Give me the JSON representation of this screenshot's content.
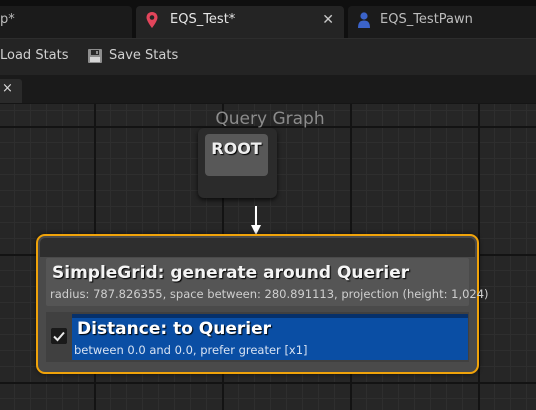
{
  "tabs": [
    {
      "label": "p*"
    },
    {
      "label": "EQS_Test*",
      "active": true,
      "icon": "location-pin-icon"
    },
    {
      "label": "EQS_TestPawn",
      "icon": "pawn-icon"
    }
  ],
  "toolbar": {
    "load_label": "Load Stats",
    "save_label": "Save Stats"
  },
  "strip": {
    "close_glyph": "×"
  },
  "graph": {
    "title": "Query Graph",
    "root_label": "ROOT",
    "generator": {
      "title": "SimpleGrid: generate around Querier",
      "description": "radius: 787.826355, space between: 280.891113, projection (height: 1,024)"
    },
    "test": {
      "title": "Distance: to Querier",
      "description": "between 0.0 and 0.0, prefer greater [x1]",
      "enabled": true
    }
  },
  "colors": {
    "accent_border": "#f0a30a",
    "test_node": "#0a4ea4",
    "pin_icon": "#e2455b",
    "pawn_icon": "#3b63c9"
  }
}
